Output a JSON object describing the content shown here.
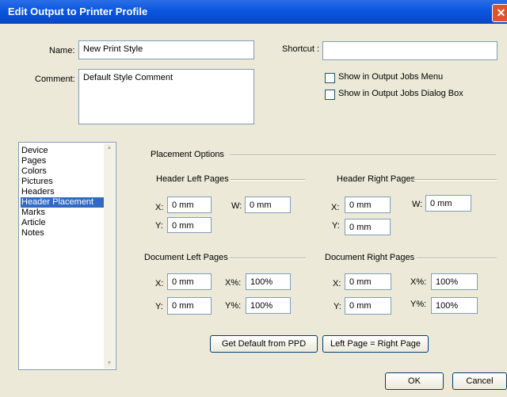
{
  "window": {
    "title": "Edit Output to Printer Profile",
    "close_glyph": "✕"
  },
  "name": {
    "label": "Name:",
    "value": "New Print Style"
  },
  "shortcut": {
    "label": "Shortcut :",
    "value": ""
  },
  "comment": {
    "label": "Comment:",
    "value": "Default Style Comment"
  },
  "options": {
    "show_menu": "Show in Output Jobs Menu",
    "show_dialog": "Show in Output Jobs Dialog Box"
  },
  "sidebar": {
    "items": [
      "Device",
      "Pages",
      "Colors",
      "Pictures",
      "Headers",
      "Header Placement",
      "Marks",
      "Article",
      "Notes"
    ],
    "selected": "Header Placement"
  },
  "placement": {
    "title": "Placement Options",
    "header_left": {
      "title": "Header Left Pages",
      "x_label": "X:",
      "x": "0 mm",
      "w_label": "W:",
      "w": "0 mm",
      "y_label": "Y:",
      "y": "0 mm"
    },
    "header_right": {
      "title": "Header Right Pages",
      "x_label": "X:",
      "x": "0 mm",
      "w_label": "W:",
      "w": "0 mm",
      "y_label": "Y:",
      "y": "0 mm"
    },
    "doc_left": {
      "title": "Document Left Pages",
      "x_label": "X:",
      "x": "0 mm",
      "xp_label": "X%:",
      "xp": "100%",
      "y_label": "Y:",
      "y": "0 mm",
      "yp_label": "Y%:",
      "yp": "100%"
    },
    "doc_right": {
      "title": "Document Right Pages",
      "x_label": "X:",
      "x": "0 mm",
      "xp_label": "X%:",
      "xp": "100%",
      "y_label": "Y:",
      "y": "0 mm",
      "yp_label": "Y%:",
      "yp": "100%"
    }
  },
  "buttons": {
    "default_ppd": "Get Default from PPD",
    "left_right": "Left Page = Right Page",
    "ok": "OK",
    "cancel": "Cancel"
  },
  "colors": {
    "titlebar": "#0a56e0",
    "selection": "#316ac5",
    "dialog_bg": "#ece9d8"
  }
}
